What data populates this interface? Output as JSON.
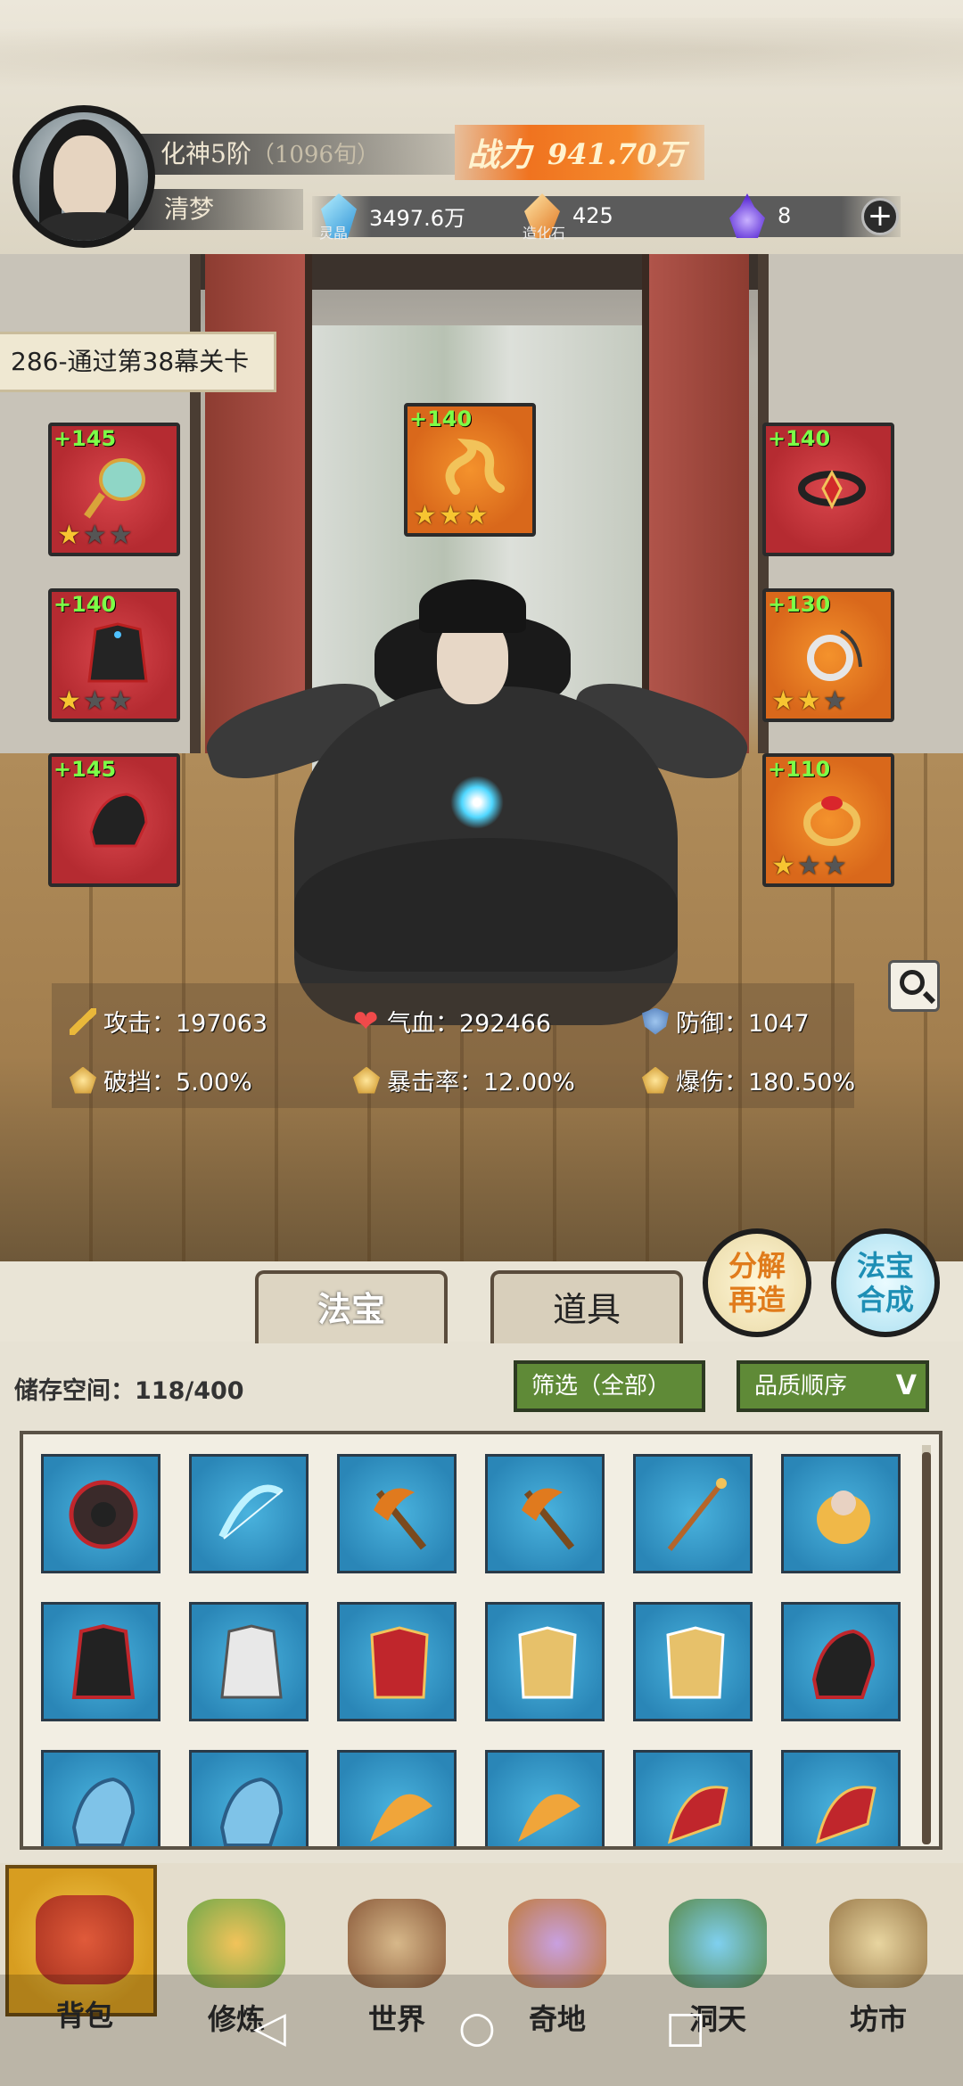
{
  "header": {
    "realm": "化神5阶",
    "age": "（1096旬）",
    "player_name": "清梦",
    "power_label": "战力",
    "power_value": "941.70万",
    "resources": [
      {
        "icon": "spirit-crystal-icon",
        "caption": "灵晶",
        "value": "3497.6万"
      },
      {
        "icon": "creation-stone-icon",
        "caption": "造化石",
        "value": "425"
      },
      {
        "icon": "purple-flame-icon",
        "caption": "",
        "value": "8"
      }
    ],
    "add_label": "+"
  },
  "scene": {
    "stage_banner": "286-通过第38幕关卡"
  },
  "equipment": [
    {
      "slot": "fan",
      "bonus": "+145",
      "stars": 1,
      "color": "red"
    },
    {
      "slot": "robe",
      "bonus": "+140",
      "stars": 1,
      "color": "red"
    },
    {
      "slot": "boots",
      "bonus": "+145",
      "stars": 0,
      "color": "red"
    },
    {
      "slot": "talisman",
      "bonus": "+140",
      "stars": 3,
      "color": "orange"
    },
    {
      "slot": "headband",
      "bonus": "+140",
      "stars": 0,
      "color": "red"
    },
    {
      "slot": "amulet",
      "bonus": "+130",
      "stars": 2,
      "color": "orange"
    },
    {
      "slot": "ring",
      "bonus": "+110",
      "stars": 1,
      "color": "orange"
    }
  ],
  "stats": {
    "attack": "攻击：197063",
    "hp": "气血：292466",
    "defense": "防御：1047",
    "break_block": "破挡：5.00%",
    "crit_rate": "暴击率：12.00%",
    "crit_damage": "爆伤：180.50%"
  },
  "actions": {
    "decompose_line1": "分解",
    "decompose_line2": "再造",
    "synth_line1": "法宝",
    "synth_line2": "合成"
  },
  "bag": {
    "tabs": [
      "法宝",
      "道具"
    ],
    "storage": "储存空间：118/400",
    "filter": "筛选（全部）",
    "sort": "品质顺序"
  },
  "nav": [
    "背包",
    "修炼",
    "世界",
    "奇地",
    "洞天",
    "坊市"
  ],
  "colors": {
    "red_slot": "#c2353b",
    "orange_slot": "#e07820",
    "bag_cell": "#3497c8",
    "bonus_green": "#7cff47",
    "filter_green": "#5f8a37"
  }
}
